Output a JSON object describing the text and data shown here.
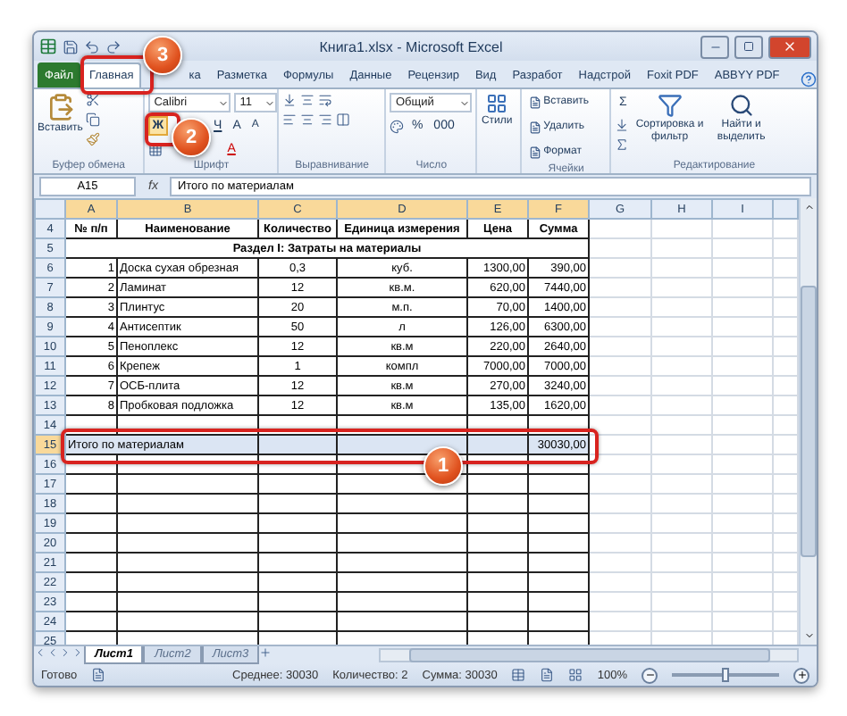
{
  "window": {
    "title": "Книга1.xlsx - Microsoft Excel"
  },
  "ribbon_tabs": [
    {
      "label": "Файл",
      "kind": "file",
      "selected": false
    },
    {
      "label": "Главная",
      "kind": "tab",
      "selected": true
    },
    {
      "label": "ка",
      "kind": "tab",
      "selected": false
    },
    {
      "label": "Разметка",
      "kind": "tab",
      "selected": false
    },
    {
      "label": "Формулы",
      "kind": "tab",
      "selected": false
    },
    {
      "label": "Данные",
      "kind": "tab",
      "selected": false
    },
    {
      "label": "Рецензир",
      "kind": "tab",
      "selected": false
    },
    {
      "label": "Вид",
      "kind": "tab",
      "selected": false
    },
    {
      "label": "Разработ",
      "kind": "tab",
      "selected": false
    },
    {
      "label": "Надстрой",
      "kind": "tab",
      "selected": false
    },
    {
      "label": "Foxit PDF",
      "kind": "tab",
      "selected": false
    },
    {
      "label": "ABBYY PDF",
      "kind": "tab",
      "selected": false
    }
  ],
  "clipboard": {
    "paste": "Вставить",
    "label": "Буфер обмена"
  },
  "font": {
    "name": "Calibri",
    "size": "11",
    "bold": "Ж",
    "bold_active": true,
    "underline": "Ч",
    "grow": "A",
    "shrink": "A",
    "color_letter": "A",
    "label": "Шрифт"
  },
  "alignment": {
    "label": "Выравнивание"
  },
  "number": {
    "format": "Общий",
    "percent": "%",
    "thousands": "000",
    "label": "Число"
  },
  "styles": {
    "button": "Стили"
  },
  "cells": {
    "items": [
      "Вставить",
      "Удалить",
      "Формат"
    ],
    "label": "Ячейки"
  },
  "editing": {
    "sum": "Σ",
    "sort": "Сортировка и фильтр",
    "find": "Найти и выделить",
    "label": "Редактирование"
  },
  "formula_bar": {
    "name_box": "A15",
    "fx": "fx",
    "content": "Итого по материалам"
  },
  "columns": [
    {
      "label": "A",
      "selected": true
    },
    {
      "label": "B",
      "selected": true
    },
    {
      "label": "C",
      "selected": true
    },
    {
      "label": "D",
      "selected": true
    },
    {
      "label": "E",
      "selected": true
    },
    {
      "label": "F",
      "selected": true
    },
    {
      "label": "G",
      "selected": false
    },
    {
      "label": "H",
      "selected": false
    },
    {
      "label": "I",
      "selected": false
    }
  ],
  "rows": [
    {
      "number": "4",
      "kind": "header",
      "selected": false,
      "cells": [
        "№ п/п",
        "Наименование",
        "Количество",
        "Единица измерения",
        "Цена",
        "Сумма"
      ]
    },
    {
      "number": "5",
      "kind": "section",
      "selected": false,
      "text": "Раздел I: Затраты на материалы"
    },
    {
      "number": "6",
      "kind": "item",
      "selected": false,
      "cells": [
        "1",
        "Доска сухая обрезная",
        "0,3",
        "куб.",
        "1300,00",
        "390,00"
      ]
    },
    {
      "number": "7",
      "kind": "item",
      "selected": false,
      "cells": [
        "2",
        "Ламинат",
        "12",
        "кв.м.",
        "620,00",
        "7440,00"
      ]
    },
    {
      "number": "8",
      "kind": "item",
      "selected": false,
      "cells": [
        "3",
        "Плинтус",
        "20",
        "м.п.",
        "70,00",
        "1400,00"
      ]
    },
    {
      "number": "9",
      "kind": "item",
      "selected": false,
      "cells": [
        "4",
        "Антисептик",
        "50",
        "л",
        "126,00",
        "6300,00"
      ]
    },
    {
      "number": "10",
      "kind": "item",
      "selected": false,
      "cells": [
        "5",
        "Пеноплекс",
        "12",
        "кв.м",
        "220,00",
        "2640,00"
      ]
    },
    {
      "number": "11",
      "kind": "item",
      "selected": false,
      "cells": [
        "6",
        "Крепеж",
        "1",
        "компл",
        "7000,00",
        "7000,00"
      ]
    },
    {
      "number": "12",
      "kind": "item",
      "selected": false,
      "cells": [
        "7",
        "ОСБ-плита",
        "12",
        "кв.м",
        "270,00",
        "3240,00"
      ]
    },
    {
      "number": "13",
      "kind": "item",
      "selected": false,
      "cells": [
        "8",
        "Пробковая подложка",
        "12",
        "кв.м",
        "135,00",
        "1620,00"
      ]
    },
    {
      "number": "14",
      "kind": "empty",
      "selected": false
    },
    {
      "number": "15",
      "kind": "total",
      "selected": true,
      "label": "Итого по материалам",
      "sum": "30030,00"
    },
    {
      "number": "16",
      "kind": "empty",
      "selected": false
    },
    {
      "number": "17",
      "kind": "empty",
      "selected": false
    },
    {
      "number": "18",
      "kind": "empty",
      "selected": false
    },
    {
      "number": "19",
      "kind": "empty",
      "selected": false
    },
    {
      "number": "20",
      "kind": "empty",
      "selected": false
    },
    {
      "number": "21",
      "kind": "empty",
      "selected": false
    },
    {
      "number": "22",
      "kind": "empty",
      "selected": false
    },
    {
      "number": "23",
      "kind": "empty",
      "selected": false
    },
    {
      "number": "24",
      "kind": "empty",
      "selected": false
    },
    {
      "number": "25",
      "kind": "empty",
      "selected": false
    }
  ],
  "sheet_tabs": [
    {
      "label": "Лист1",
      "selected": true
    },
    {
      "label": "Лист2",
      "selected": false
    },
    {
      "label": "Лист3",
      "selected": false
    }
  ],
  "status_bar": {
    "ready": "Готово",
    "average": "Среднее: 30030",
    "count": "Количество: 2",
    "sum": "Сумма: 30030",
    "zoom": "100%",
    "zoom_slider": {
      "level": 0.5
    }
  },
  "callouts": [
    {
      "label": "1"
    },
    {
      "label": "2"
    },
    {
      "label": "3"
    }
  ]
}
